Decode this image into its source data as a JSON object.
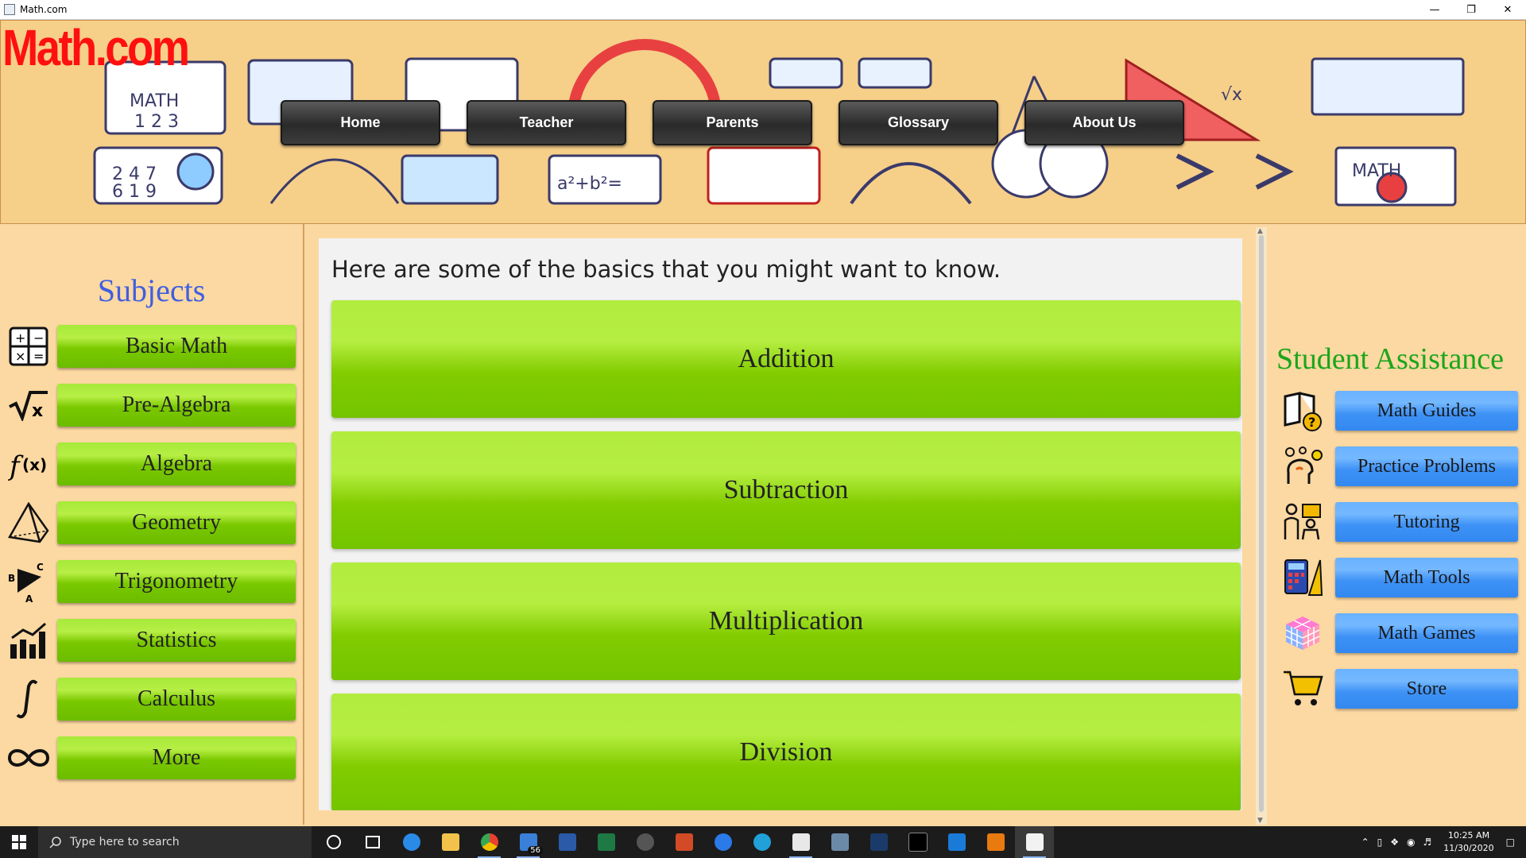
{
  "window": {
    "title": "Math.com",
    "controls": [
      "minimize",
      "restore",
      "close"
    ]
  },
  "header": {
    "logo": "Math.com",
    "nav": [
      "Home",
      "Teacher",
      "Parents",
      "Glossary",
      "About Us"
    ]
  },
  "subjects": {
    "title": "Subjects",
    "items": [
      {
        "label": "Basic Math",
        "icon": "calculator-grid-icon"
      },
      {
        "label": "Pre-Algebra",
        "icon": "square-root-icon"
      },
      {
        "label": "Algebra",
        "icon": "function-icon"
      },
      {
        "label": "Geometry",
        "icon": "pyramid-icon"
      },
      {
        "label": "Trigonometry",
        "icon": "triangle-abc-icon"
      },
      {
        "label": "Statistics",
        "icon": "bar-chart-icon"
      },
      {
        "label": "Calculus",
        "icon": "integral-icon"
      },
      {
        "label": "More",
        "icon": "infinity-icon"
      }
    ]
  },
  "main": {
    "intro": "Here are some of the basics that you might want to know.",
    "topics": [
      "Addition",
      "Subtraction",
      "Multiplication",
      "Division"
    ]
  },
  "assistance": {
    "title": "Student Assistance",
    "items": [
      {
        "label": "Math Guides",
        "icon": "book-help-icon"
      },
      {
        "label": "Practice Problems",
        "icon": "thinking-head-icon"
      },
      {
        "label": "Tutoring",
        "icon": "tutor-icon"
      },
      {
        "label": "Math Tools",
        "icon": "calculator-ruler-icon"
      },
      {
        "label": "Math Games",
        "icon": "rubiks-cube-icon"
      },
      {
        "label": "Store",
        "icon": "shopping-cart-icon"
      }
    ]
  },
  "taskbar": {
    "search_placeholder": "Type here to search",
    "mail_badge": "56",
    "time": "10:25 AM",
    "date": "11/30/2020"
  },
  "colors": {
    "background": "#fbd8a0",
    "subject_button": "#8cd414",
    "assist_button": "#4a9cf8",
    "subjects_title": "#3f5fe0",
    "assist_title": "#1aa61a",
    "logo": "#ff1010"
  }
}
